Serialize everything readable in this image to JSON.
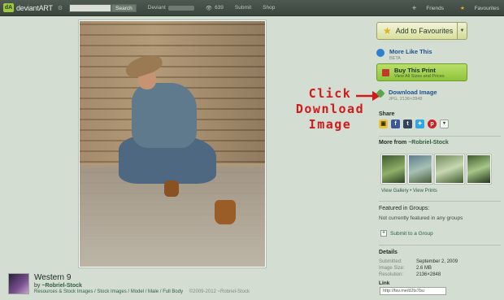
{
  "topbar": {
    "logo_badge": "dA",
    "logo_text": "deviantART",
    "search_button": "Search",
    "deviant_label": "Deviant",
    "views_count": "639",
    "submit_label": "Submit",
    "shop_label": "Shop",
    "friends_label": "Friends",
    "favourites_label": "Favourites"
  },
  "deviation": {
    "title": "Western 9",
    "by_prefix": "by",
    "author": "~Robriel-Stock",
    "categories": "Resources & Stock Images / Stock Images / Model / Male / Full Body",
    "copyright": "©2009-2012 ~Robriel-Stock"
  },
  "annotation": {
    "line1": "Click",
    "line2": "Download",
    "line3": "Image",
    "color": "#d11a1a"
  },
  "sidebar": {
    "add_favourites": "Add to Favourites",
    "more_like_this": "More Like This",
    "more_like_this_sub": "BETA",
    "buy_print": "Buy This Print",
    "buy_print_sub": "View All Sizes and Prices",
    "download_image": "Download Image",
    "download_image_sub": "JPG, 2136×2848",
    "share_title": "Share",
    "more_from_label": "More from",
    "more_from_user": "~Robriel-Stock",
    "view_gallery": "View Gallery",
    "link_separator": "•",
    "view_prints": "View Prints",
    "featured_title": "Featured in Groups:",
    "featured_status": "Not currently featured in any groups",
    "submit_group": "Submit to a Group",
    "details_title": "Details",
    "details": [
      {
        "key": "Submitted:",
        "value": "September 2, 2009"
      },
      {
        "key": "Image Size:",
        "value": "2.6 MB"
      },
      {
        "key": "Resolution:",
        "value": "2136×2848"
      }
    ],
    "link_label": "Link",
    "link_value": "http://fav.me/d2ts7bu"
  },
  "colors": {
    "accent_green": "#8fc33a",
    "annotation_red": "#d11a1a",
    "link_blue": "#1f4f8f"
  }
}
